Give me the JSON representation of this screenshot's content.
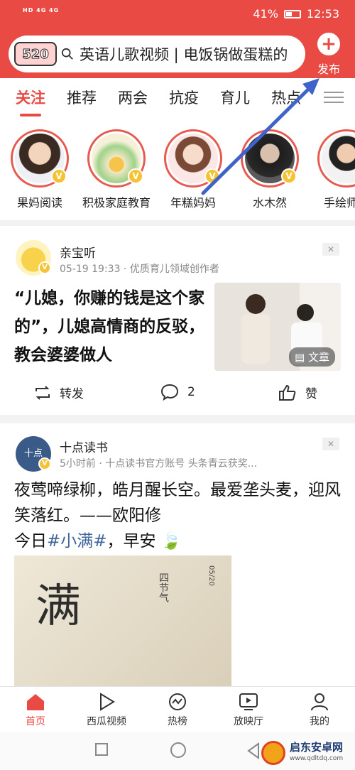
{
  "status_bar": {
    "signal_left": "HD 4G 4G",
    "battery_pct": "41%",
    "time": "12:53"
  },
  "search": {
    "badge": "520",
    "query": "英语儿歌视频 | 电饭锅做蛋糕的"
  },
  "publish_label": "发布",
  "tabs": [
    {
      "label": "关注",
      "active": true
    },
    {
      "label": "推荐"
    },
    {
      "label": "两会"
    },
    {
      "label": "抗疫"
    },
    {
      "label": "育儿"
    },
    {
      "label": "热点"
    }
  ],
  "stories": [
    {
      "name": "果妈阅读"
    },
    {
      "name": "积极家庭教育"
    },
    {
      "name": "年糕妈妈"
    },
    {
      "name": "水木然"
    },
    {
      "name": "手绘师才"
    }
  ],
  "post1": {
    "author": "亲宝听",
    "meta": "05-19 19:33 · 优质育儿领域创作者",
    "title": "“儿媳，你赚的钱是这个家的”，儿媳高情商的反驳，教会婆婆做人",
    "thumb_tag": "文章",
    "repost_label": "转发",
    "comments": "2",
    "like_label": "赞"
  },
  "post2": {
    "author": "十点读书",
    "meta": "5小时前 · 十点读书官方账号 头条青云获奖...",
    "line1": "夜莺啼绿柳，皓月醒长空。最爱垄头麦，迎风笑落红。——欧阳修",
    "line3_prefix": "今日",
    "hashtag": "#小满#",
    "line3_suffix": "，早安 🍃",
    "image_char": "满",
    "image_side": "四节气",
    "image_date": "05/20"
  },
  "bottom_nav": [
    {
      "label": "首页",
      "active": true
    },
    {
      "label": "西瓜视频"
    },
    {
      "label": "热榜"
    },
    {
      "label": "放映厅"
    },
    {
      "label": "我的"
    }
  ],
  "watermark": {
    "name": "启东安卓网",
    "url": "www.qdltdq.com"
  },
  "colors": {
    "brand": "#ea4a44",
    "link": "#406599",
    "vip": "#f5c232"
  }
}
